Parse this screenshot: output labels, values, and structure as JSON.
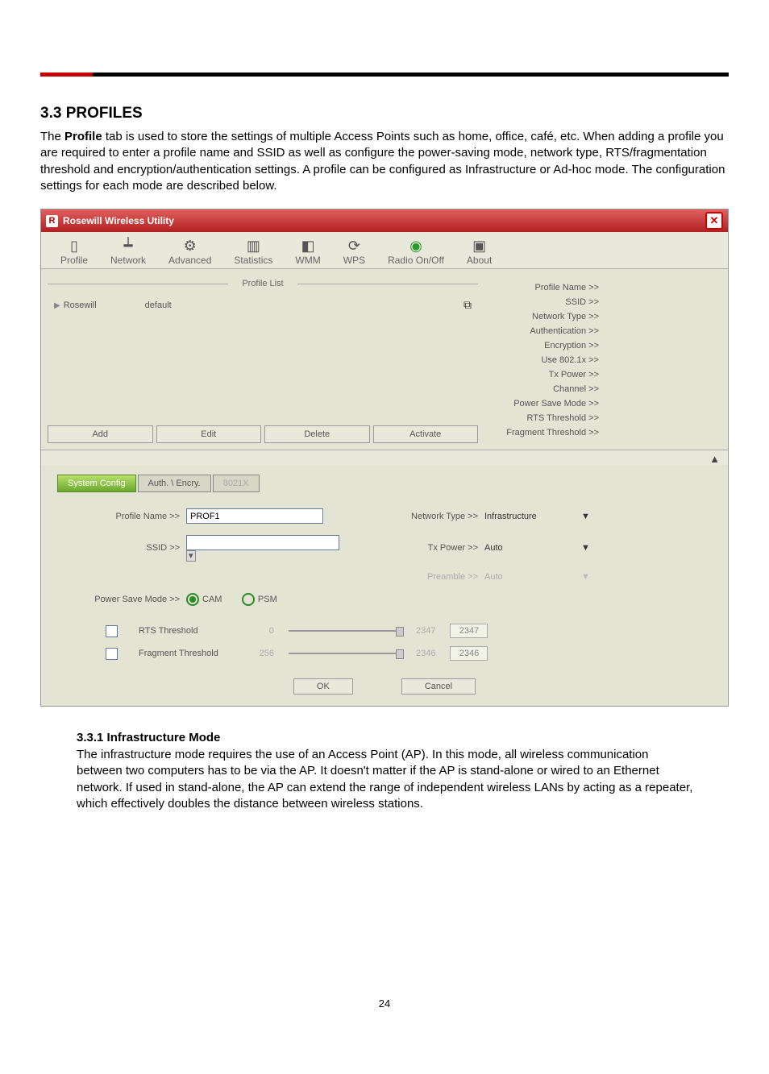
{
  "heading": "3.3  PROFILES",
  "intro": {
    "a": "The ",
    "b": "Profile",
    "c": " tab is used to store the settings of multiple Access Points such as home, office, café, etc. When adding a profile you are required to enter a profile name and SSID as well as configure the power-saving mode, network type, RTS/fragmentation threshold and encryption/authentication settings.  A profile can be configured as Infrastructure or Ad-hoc mode. The configuration settings for each mode are described below."
  },
  "window": {
    "title": "Rosewill Wireless Utility",
    "toolbar": [
      "Profile",
      "Network",
      "Advanced",
      "Statistics",
      "WMM",
      "WPS",
      "Radio On/Off",
      "About"
    ],
    "profile_list_label": "Profile List",
    "profile_row": {
      "name": "Rosewill",
      "ssid": "default"
    },
    "buttons": [
      "Add",
      "Edit",
      "Delete",
      "Activate"
    ],
    "details": [
      "Profile Name >>",
      "SSID >>",
      "Network Type >>",
      "Authentication >>",
      "Encryption >>",
      "Use 802.1x >>",
      "Tx Power >>",
      "Channel >>",
      "Power Save Mode >>",
      "RTS Threshold >>",
      "Fragment Threshold >>"
    ],
    "tabs": [
      "System Config",
      "Auth. \\ Encry.",
      "8021X"
    ],
    "form": {
      "profile_name_label": "Profile Name >>",
      "profile_name_value": "PROF1",
      "ssid_label": "SSID >>",
      "net_type_label": "Network Type >>",
      "net_type_value": "Infrastructure",
      "tx_label": "Tx Power >>",
      "tx_value": "Auto",
      "preamble_label": "Preamble >>",
      "preamble_value": "Auto",
      "psm_label": "Power Save Mode >>",
      "psm_cam": "CAM",
      "psm_psm": "PSM",
      "rts_label": "RTS Threshold",
      "rts_min": "0",
      "rts_max": "2347",
      "rts_val": "2347",
      "frag_label": "Fragment Threshold",
      "frag_min": "256",
      "frag_max": "2346",
      "frag_val": "2346",
      "ok": "OK",
      "cancel": "Cancel"
    }
  },
  "sub_heading": "3.3.1  Infrastructure Mode",
  "sub_text": "The infrastructure mode requires the use of an Access Point (AP). In this mode, all wireless communication between two computers has to be via the AP. It doesn't matter if the AP is stand-alone or wired to an Ethernet network. If used in stand-alone, the AP can extend the range of independent wireless LANs by acting as a repeater, which effectively doubles the distance between wireless stations.",
  "pagenum": "24"
}
